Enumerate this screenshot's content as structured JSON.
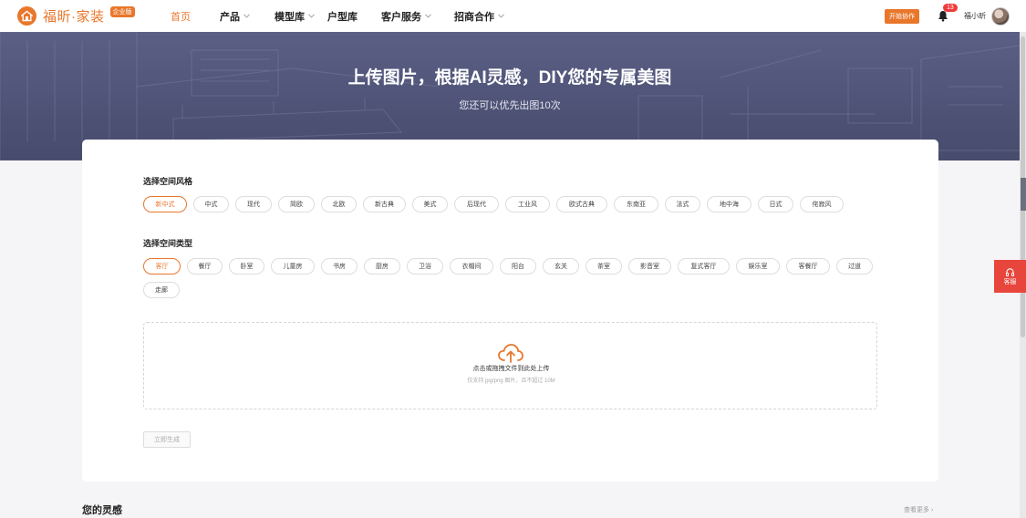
{
  "brand": {
    "name": "福昕·家装",
    "badge": "企业版"
  },
  "nav": {
    "items": [
      {
        "label": "首页",
        "active": true,
        "dropdown": false
      },
      {
        "label": "产品",
        "active": false,
        "dropdown": true
      },
      {
        "label": "模型库",
        "active": false,
        "dropdown": true
      },
      {
        "label": "户型库",
        "active": false,
        "dropdown": false
      },
      {
        "label": "客户服务",
        "active": false,
        "dropdown": true
      },
      {
        "label": "招商合作",
        "active": false,
        "dropdown": true
      }
    ],
    "start_label": "开始协作",
    "notification_count": "13",
    "user_name": "福小昕"
  },
  "hero": {
    "title": "上传图片，根据AI灵感，DIY您的专属美图",
    "subtitle": "您还可以优先出图10次"
  },
  "style_section": {
    "label": "选择空间风格",
    "options": [
      "新中式",
      "中式",
      "现代",
      "简欧",
      "北欧",
      "新古典",
      "美式",
      "后现代",
      "工业风",
      "欧式古典",
      "东南亚",
      "法式",
      "地中海",
      "日式",
      "侘寂风"
    ],
    "selected": "新中式"
  },
  "type_section": {
    "label": "选择空间类型",
    "options": [
      "客厅",
      "餐厅",
      "卧室",
      "儿童房",
      "书房",
      "厨房",
      "卫浴",
      "衣帽间",
      "阳台",
      "玄关",
      "茶室",
      "影音室",
      "复式客厅",
      "娱乐室",
      "客餐厅",
      "过道",
      "走廊"
    ],
    "selected": "客厅"
  },
  "upload": {
    "text": "点击或拖拽文件到此处上传",
    "hint": "仅支持 jpg/png 图片，且不超过 10M"
  },
  "generate_label": "立即生成",
  "inspiration": {
    "title": "您的灵感",
    "more": "查看更多"
  },
  "float_service": "客服",
  "colors": {
    "accent": "#e8772c",
    "hero": "#4f5478",
    "service": "#e8463c"
  }
}
